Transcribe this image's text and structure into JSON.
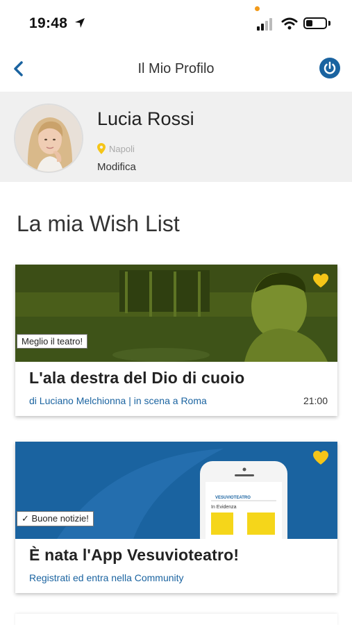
{
  "status_bar": {
    "time": "19:48"
  },
  "header": {
    "title": "Il Mio Profilo"
  },
  "profile": {
    "name": "Lucia Rossi",
    "city": "Napoli",
    "edit_label": "Modifica"
  },
  "wishlist": {
    "title": "La mia Wish List",
    "cards": [
      {
        "tag": "Meglio il teatro!",
        "title": "L'ala destra del Dio di cuoio",
        "subtitle": "di Luciano Melchionna | in scena a Roma",
        "time": "21:00"
      },
      {
        "tag": "✓ Buone notizie!",
        "title": "È nata l'App Vesuvioteatro!",
        "subtitle": "Registrati ed entra nella Community",
        "phone_brand": "VESUVIOTEATRO",
        "phone_section": "In Evidenza"
      }
    ]
  },
  "colors": {
    "accent": "#1a63a0",
    "heart": "#f5c518",
    "pin": "#f5c518"
  }
}
